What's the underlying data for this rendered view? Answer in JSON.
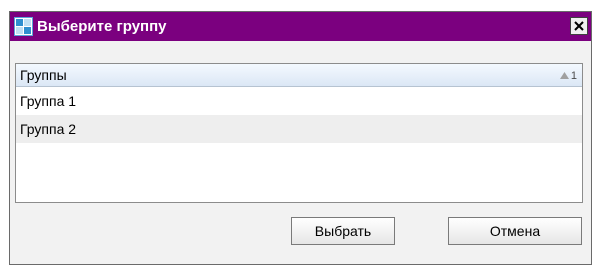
{
  "window": {
    "title": "Выберите группу",
    "icon": "app-logo-icon",
    "close_icon": "close-icon",
    "accent_color": "#7b007f"
  },
  "list": {
    "column_header": "Группы",
    "sort": {
      "arrow_icon": "sort-ascending-icon",
      "index": "1"
    },
    "rows": [
      {
        "label": "Группа 1"
      },
      {
        "label": "Группа 2"
      }
    ]
  },
  "buttons": {
    "select_label": "Выбрать",
    "cancel_label": "Отмена"
  }
}
